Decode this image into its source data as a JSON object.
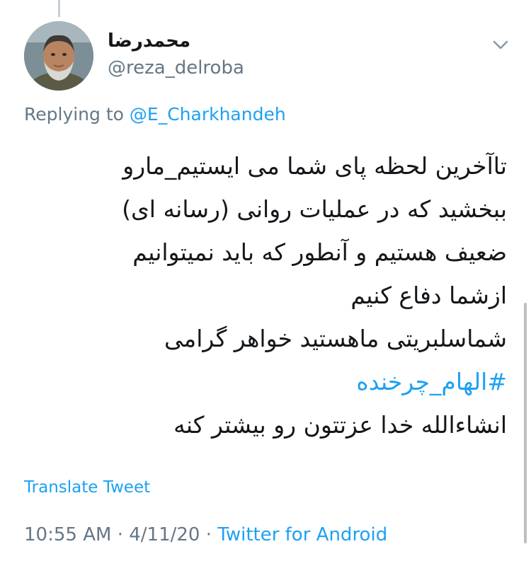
{
  "tweet": {
    "display_name": "محمدرضا",
    "handle": "@reza_delroba",
    "replying_prefix": "Replying to",
    "replying_to": "@E_Charkhandeh",
    "body_lines": [
      "تاآخرین لحظه پای شما می ایستیم_مارو",
      "ببخشید که در عملیات روانی (رسانه ای)",
      "ضعیف هستیم و آنطور که باید نمیتوانیم",
      "ازشما دفاع کنیم",
      "شماسلبریتی ماهستید خواهر گرامی"
    ],
    "hashtag": "#الهام_چرخنده",
    "closing_line": "انشاءالله خدا عزتتون رو بیشتر کنه",
    "translate_label": "Translate Tweet",
    "time": "10:55 AM",
    "separator": "·",
    "date": "4/11/20",
    "source": "Twitter for Android"
  },
  "icons": {
    "caret": "chevron-down-icon",
    "avatar": "avatar"
  },
  "colors": {
    "accent": "#1da1f2",
    "secondary_text": "#657786",
    "primary_text": "#14171a"
  }
}
